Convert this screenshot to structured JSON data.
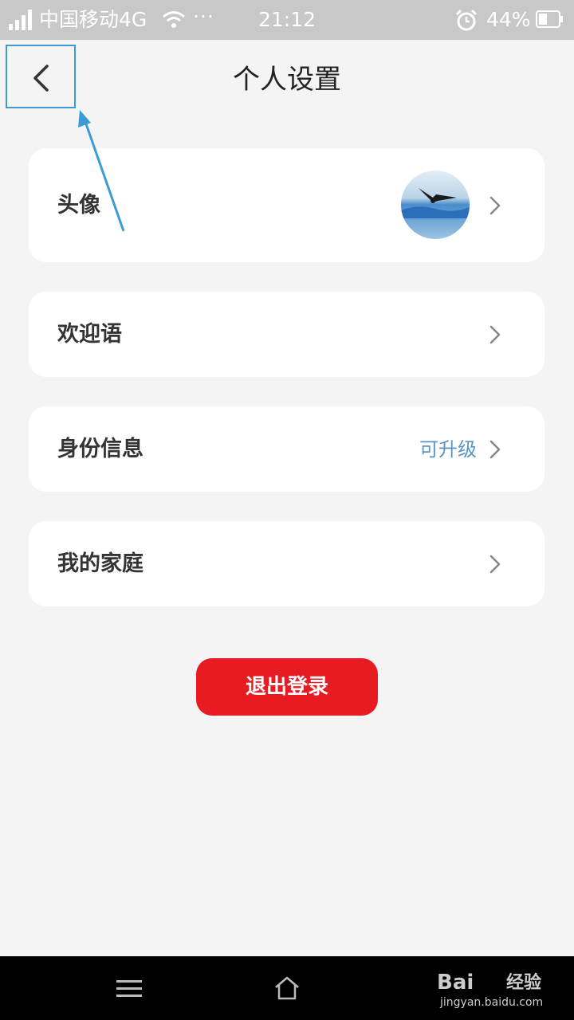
{
  "status_bar": {
    "carrier": "中国移动4G",
    "more": "···",
    "time": "21:12",
    "battery": "44%",
    "battery_level": 0.44,
    "icons": [
      "signal-icon",
      "wifi-icon",
      "alarm-icon",
      "battery-icon"
    ]
  },
  "header": {
    "title": "个人设置",
    "back_icon": "chevron-left-icon"
  },
  "rows": [
    {
      "label": "头像",
      "icon": "chevron-right-icon",
      "avatar": "eagle-avatar"
    },
    {
      "label": "欢迎语",
      "icon": "chevron-right-icon"
    },
    {
      "label": "身份信息",
      "extra": "可升级",
      "icon": "chevron-right-icon"
    },
    {
      "label": "我的家庭",
      "icon": "chevron-right-icon"
    }
  ],
  "logout_label": "退出登录",
  "nav_bar": {
    "icons": [
      "menu-icon",
      "home-icon"
    ]
  },
  "watermark": {
    "brand": "Bai",
    "brand_cn": "经验",
    "url": "jingyan.baidu.com"
  },
  "colors": {
    "accent_red": "#e81b23",
    "link_blue": "#5b94c4",
    "annotation_blue": "#3c9ad6"
  }
}
